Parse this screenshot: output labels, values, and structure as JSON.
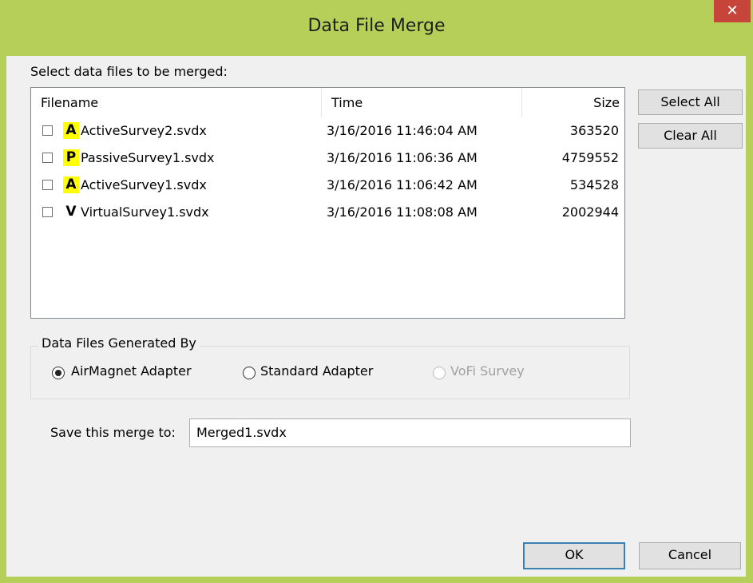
{
  "window": {
    "title": "Data File Merge",
    "close_glyph": "✕"
  },
  "files_section": {
    "label": "Select data files to be merged:"
  },
  "list": {
    "headers": {
      "filename": "Filename",
      "time": "Time",
      "size": "Size"
    },
    "rows": [
      {
        "badge": "A",
        "badge_highlight": true,
        "filename": "ActiveSurvey2.svdx",
        "time": "3/16/2016 11:46:04 AM",
        "size": "363520",
        "checked": false
      },
      {
        "badge": "P",
        "badge_highlight": true,
        "filename": "PassiveSurvey1.svdx",
        "time": "3/16/2016 11:06:36 AM",
        "size": "4759552",
        "checked": false
      },
      {
        "badge": "A",
        "badge_highlight": true,
        "filename": "ActiveSurvey1.svdx",
        "time": "3/16/2016 11:06:42 AM",
        "size": "534528",
        "checked": false
      },
      {
        "badge": "V",
        "badge_highlight": false,
        "filename": "VirtualSurvey1.svdx",
        "time": "3/16/2016 11:08:08 AM",
        "size": "2002944",
        "checked": false
      }
    ]
  },
  "buttons": {
    "select_all": "Select All",
    "clear_all": "Clear All",
    "ok": "OK",
    "cancel": "Cancel"
  },
  "generated_by": {
    "legend": "Data Files Generated By",
    "options": [
      {
        "label": "AirMagnet Adapter",
        "selected": true,
        "enabled": true
      },
      {
        "label": "Standard Adapter",
        "selected": false,
        "enabled": true
      },
      {
        "label": "VoFi Survey",
        "selected": false,
        "enabled": false
      }
    ]
  },
  "save": {
    "label": "Save this merge to:",
    "value": "Merged1.svdx"
  },
  "colors": {
    "frame": "#b6cf59",
    "close": "#c7443a",
    "highlight": "#ffff00",
    "default_button_border": "#3c7fb1"
  }
}
